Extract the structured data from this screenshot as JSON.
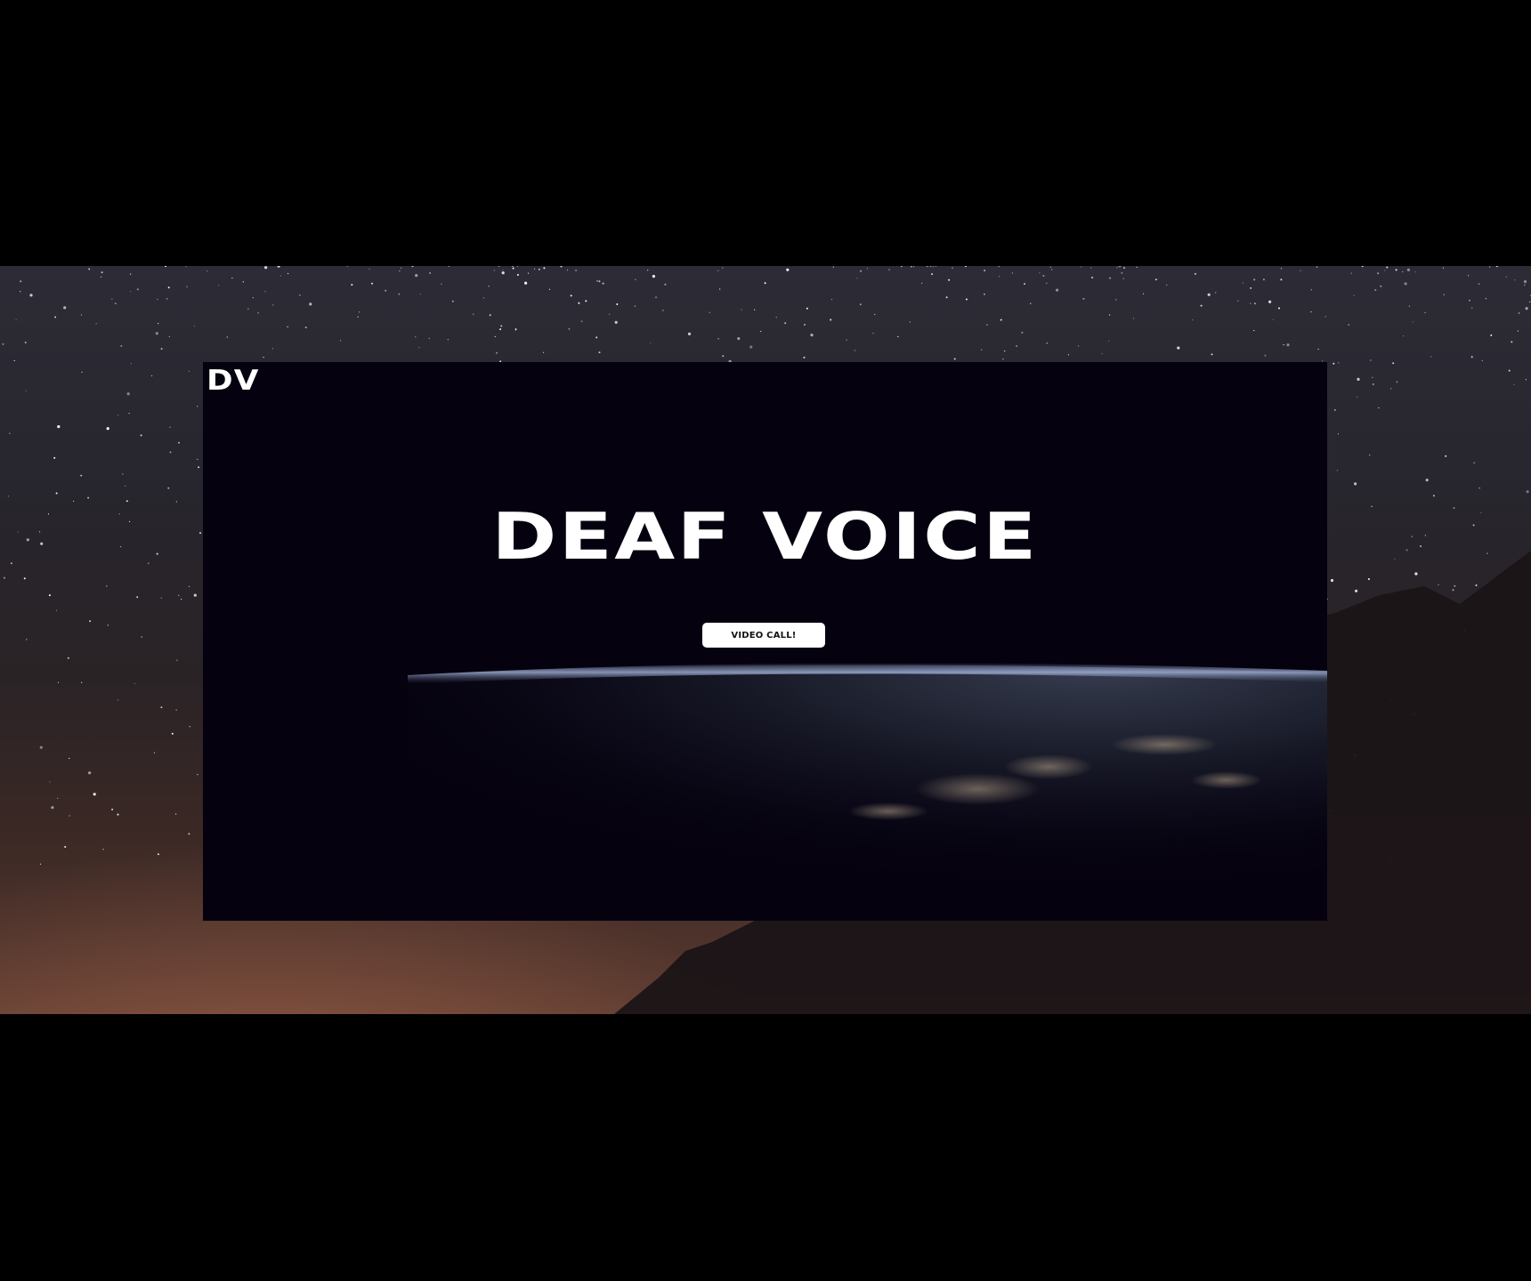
{
  "header": {
    "logo_text": "DV"
  },
  "hero": {
    "title": "DEAF VOICE",
    "cta_label": "VIDEO CALL!"
  },
  "colors": {
    "page_background": "#000000",
    "hero_background": "#05010f",
    "button_background": "#ffffff",
    "text_primary": "#ffffff"
  }
}
